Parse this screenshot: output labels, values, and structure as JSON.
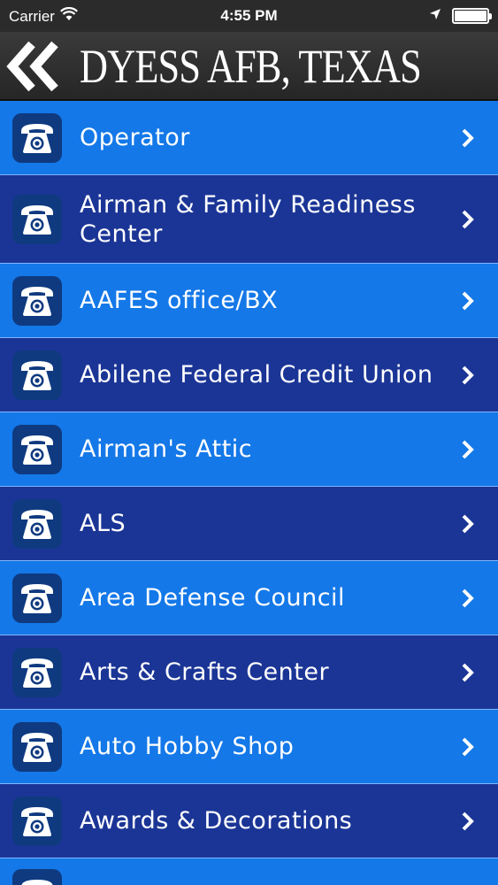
{
  "status_bar": {
    "carrier": "Carrier",
    "time": "4:55 PM",
    "battery_level": 1.0
  },
  "nav": {
    "title": "DYESS AFB, TEXAS",
    "back_icon": "double-chevron-left-icon"
  },
  "list": {
    "item_icon": "phone-icon",
    "items": [
      {
        "label": "Operator"
      },
      {
        "label": "Airman & Family Readiness Center"
      },
      {
        "label": "AAFES office/BX"
      },
      {
        "label": "Abilene Federal Credit Union"
      },
      {
        "label": "Airman's Attic"
      },
      {
        "label": "ALS"
      },
      {
        "label": "Area Defense Council"
      },
      {
        "label": "Arts & Crafts Center"
      },
      {
        "label": "Auto Hobby Shop"
      },
      {
        "label": "Awards & Decorations"
      }
    ]
  },
  "colors": {
    "row_light": "#1478e8",
    "row_dark": "#1b3596",
    "icon_bg": "#0f3a80",
    "nav_bg": "#2b2b2b"
  }
}
